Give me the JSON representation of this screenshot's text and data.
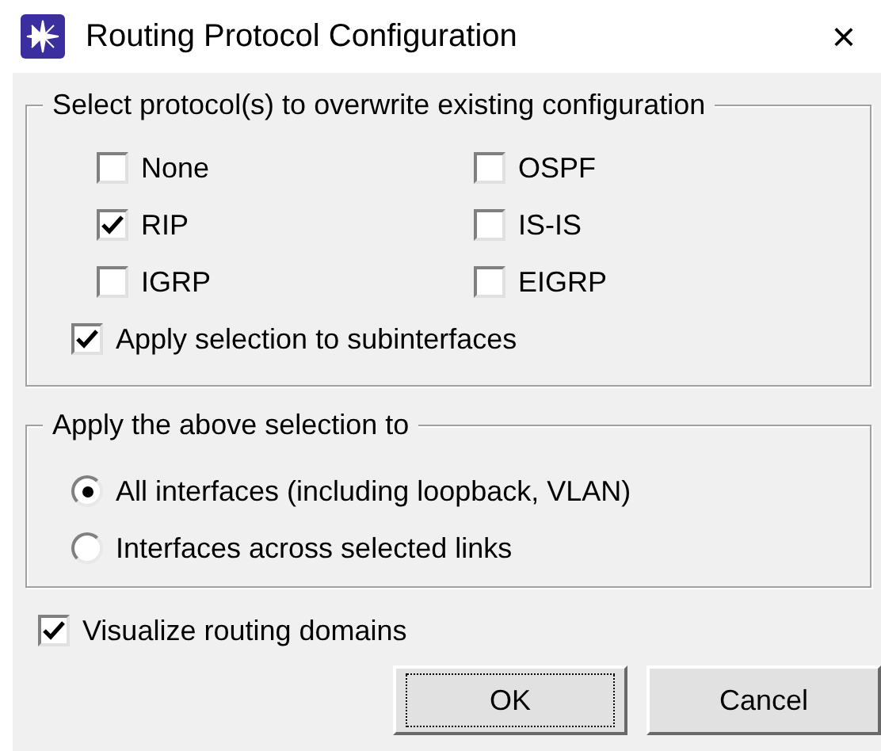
{
  "window": {
    "title": "Routing Protocol Configuration",
    "close": "×"
  },
  "protocols": {
    "legend": "Select protocol(s) to overwrite existing configuration",
    "options": [
      {
        "label": "None",
        "checked": false
      },
      {
        "label": "OSPF",
        "checked": false
      },
      {
        "label": "RIP",
        "checked": true
      },
      {
        "label": "IS-IS",
        "checked": false
      },
      {
        "label": "IGRP",
        "checked": false
      },
      {
        "label": "EIGRP",
        "checked": false
      }
    ],
    "subinterfaces": {
      "label": "Apply selection to subinterfaces",
      "checked": true
    }
  },
  "apply_to": {
    "legend": "Apply the above selection to",
    "options": [
      {
        "label": "All interfaces (including loopback, VLAN)",
        "selected": true
      },
      {
        "label": "Interfaces across selected links",
        "selected": false
      }
    ]
  },
  "visualize": {
    "label": "Visualize routing domains",
    "checked": true
  },
  "buttons": [
    {
      "label": "OK",
      "focused": true
    },
    {
      "label": "Cancel",
      "focused": false
    }
  ]
}
